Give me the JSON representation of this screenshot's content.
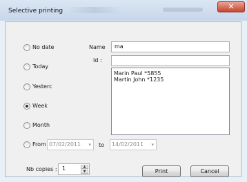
{
  "window": {
    "title": "Selective printing",
    "close_glyph": "✕"
  },
  "options": [
    {
      "label": "No date",
      "selected": false
    },
    {
      "label": "Today",
      "selected": false
    },
    {
      "label": "Yesterc",
      "selected": false
    },
    {
      "label": "Week",
      "selected": true
    },
    {
      "label": "Month",
      "selected": false
    },
    {
      "label": "From",
      "selected": false
    }
  ],
  "fields": {
    "name_label": "Name",
    "name_value": "ma",
    "id_label": "Id :",
    "id_value": ""
  },
  "results": [
    "Marin Paul *5855",
    "Martin John *1235"
  ],
  "date_range": {
    "from": "07/02/2011",
    "to_label": "to",
    "to": "14/02/2011",
    "arrow": "▾"
  },
  "copies": {
    "label": "Nb copies :",
    "value": "1"
  },
  "buttons": {
    "print": "Print",
    "cancel": "Cancel"
  }
}
